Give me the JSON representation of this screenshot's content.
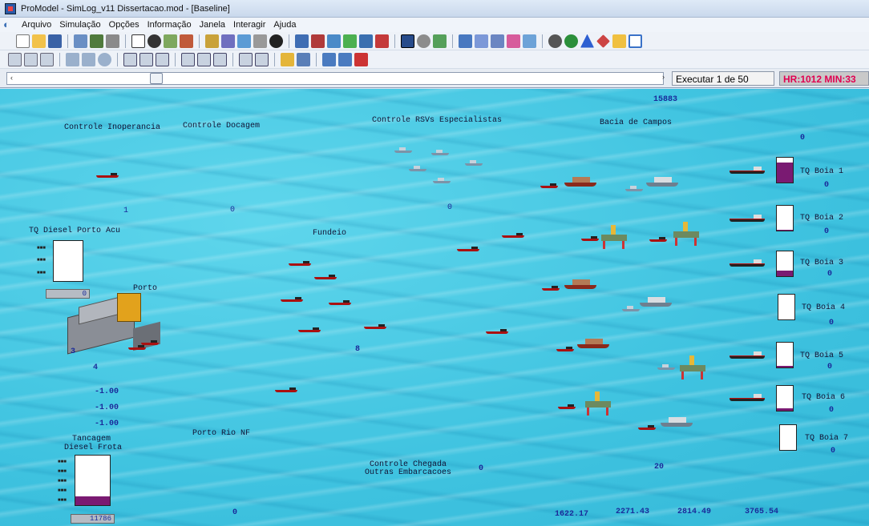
{
  "window": {
    "title": "ProModel - SimLog_v11 Dissertacao.mod - [Baseline]"
  },
  "menu": {
    "items": [
      "Arquivo",
      "Simulação",
      "Opções",
      "Informação",
      "Janela",
      "Interagir",
      "Ajuda"
    ]
  },
  "runbar": {
    "run_label": "Executar 1 de 50",
    "clock": "HR:1012 MIN:33"
  },
  "labels": {
    "controle_inoperancia": "Controle Inoperancia",
    "controle_docagem": "Controle Docagem",
    "controle_rsvs": "Controle RSVs Especialistas",
    "bacia_campos": "Bacia de Campos",
    "tq_diesel_porto_acu": "TQ Diesel Porto Acu",
    "fundeio": "Fundeio",
    "porto": "Porto",
    "porto_rio_nf": "Porto Rio NF",
    "tancagem_line1": "Tancagem",
    "tancagem_line2": "Diesel Frota",
    "controle_chegada_line1": "Controle Chegada",
    "controle_chegada_line2": "Outras Embarcacoes",
    "tq_boia_1": "TQ Boia 1",
    "tq_boia_2": "TQ Boia 2",
    "tq_boia_3": "TQ Boia 3",
    "tq_boia_4": "TQ Boia 4",
    "tq_boia_5": "TQ Boia 5",
    "tq_boia_6": "TQ Boia 6",
    "tq_boia_7": "TQ Boia 7"
  },
  "values": {
    "top_counter": "15883",
    "bacia_zero": "0",
    "one": "1",
    "zero_a": "0",
    "zero_b": "0",
    "porto_counter": "0",
    "port_left": "3",
    "port_bottom": "4",
    "fundeio_count": "8",
    "rate1": "-1.00",
    "rate2": "-1.00",
    "rate3": "-1.00",
    "tancagem_counter": "11786",
    "chegada_count": "0",
    "twenty": "20",
    "bottom_zero": "0",
    "b1": "1622.17",
    "b2": "2271.43",
    "b3": "2814.49",
    "b4": "3765.54",
    "boia_1_val": "0",
    "boia_2_val": "0",
    "boia_3_val": "0",
    "boia_4_val": "0",
    "boia_5_val": "0",
    "boia_6_val": "0",
    "boia_7_val": "0"
  },
  "tank_levels": {
    "tq_diesel_porto_acu": 0.0,
    "tancagem_diesel_frota": 0.18,
    "boia_1": 0.8,
    "boia_2": 0.04,
    "boia_3": 0.22,
    "boia_4": 0.0,
    "boia_5": 0.06,
    "boia_6": 0.1,
    "boia_7": 0.0
  },
  "colors": {
    "sea": "#3fc3e0",
    "tank_fill": "#7a1a72",
    "clock_text": "#e00050",
    "counter_text": "#1a2a9a"
  }
}
